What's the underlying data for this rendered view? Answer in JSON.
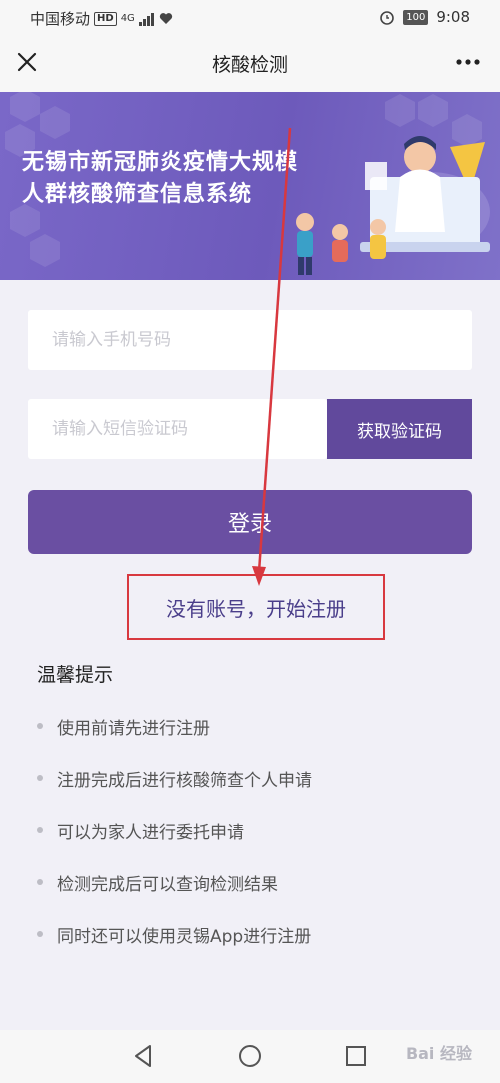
{
  "status_bar": {
    "carrier": "中国移动",
    "network_badge": "HD",
    "signal": "4G",
    "battery": "100",
    "time": "9:08"
  },
  "nav": {
    "title": "核酸检测",
    "close_icon": "close-icon",
    "more_icon": "more-icon"
  },
  "banner": {
    "title_line1": "无锡市新冠肺炎疫情大规模",
    "title_line2": "人群核酸筛查信息系统"
  },
  "form": {
    "phone_placeholder": "请输入手机号码",
    "code_placeholder": "请输入短信验证码",
    "get_code_label": "获取验证码",
    "login_label": "登录",
    "register_label": "没有账号，开始注册"
  },
  "tips": {
    "title": "温馨提示",
    "items": [
      "使用前请先进行注册",
      "注册完成后进行核酸筛查个人申请",
      "可以为家人进行委托申请",
      "检测完成后可以查询检测结果",
      "同时还可以使用灵锡App进行注册"
    ]
  },
  "watermark": "Bai 经验",
  "colors": {
    "accent": "#61499c",
    "banner": "#7a68c8",
    "annotation": "#d8383f"
  }
}
